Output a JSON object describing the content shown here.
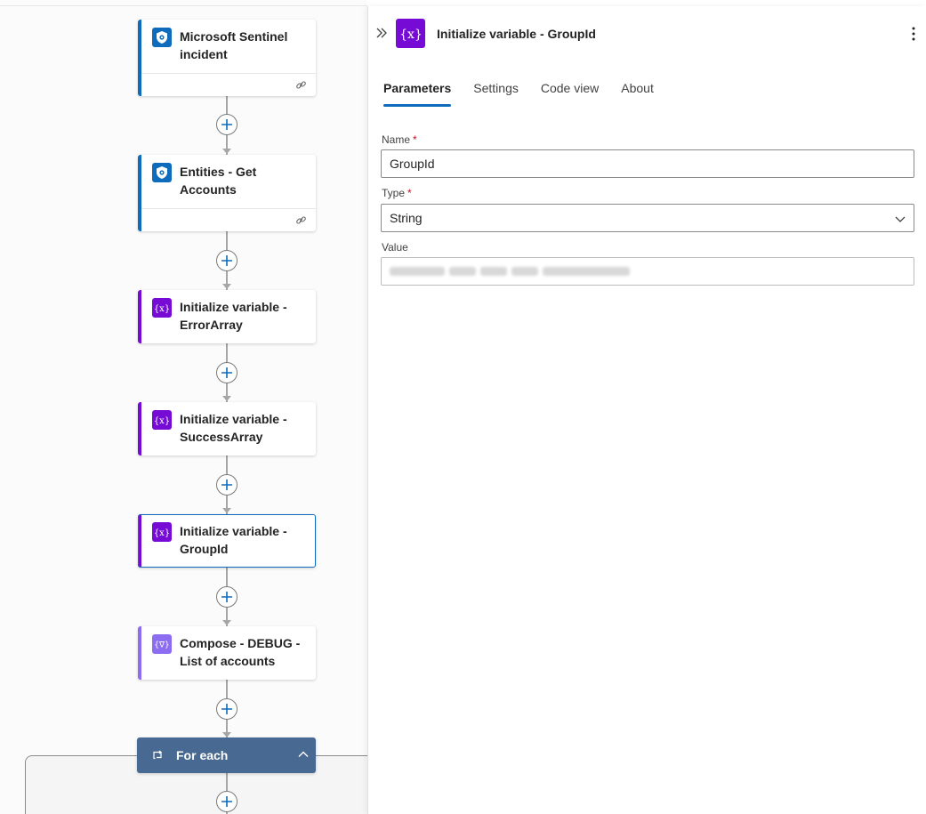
{
  "canvas": {
    "steps": [
      {
        "label": "Microsoft Sentinel incident",
        "kind": "sentinel"
      },
      {
        "label": "Entities - Get Accounts",
        "kind": "sentinel"
      },
      {
        "label": "Initialize variable - ErrorArray",
        "kind": "variable"
      },
      {
        "label": "Initialize variable - SuccessArray",
        "kind": "variable"
      },
      {
        "label": "Initialize variable - GroupId",
        "kind": "variable",
        "selected": true
      },
      {
        "label": "Compose - DEBUG - List of accounts",
        "kind": "compose"
      }
    ],
    "foreach_label": "For each",
    "icons": {
      "sentinel": "shield-eye-icon",
      "variable": "variable-braces-icon",
      "compose": "compose-icon",
      "link": "link-icon",
      "add": "plus-icon",
      "loop": "loop-icon",
      "collapse": "chevron-up-icon"
    }
  },
  "panel": {
    "title": "Initialize variable - GroupId",
    "tabs": [
      "Parameters",
      "Settings",
      "Code view",
      "About"
    ],
    "active_tab": "Parameters",
    "fields": {
      "name_label": "Name",
      "name_value": "GroupId",
      "type_label": "Type",
      "type_value": "String",
      "value_label": "Value",
      "required_mark": "*"
    }
  },
  "colors": {
    "accent": "#0f6cbd",
    "variable": "#770bd6",
    "compose": "#8c6cf0",
    "foreach": "#486991",
    "required": "#c50f1f"
  }
}
